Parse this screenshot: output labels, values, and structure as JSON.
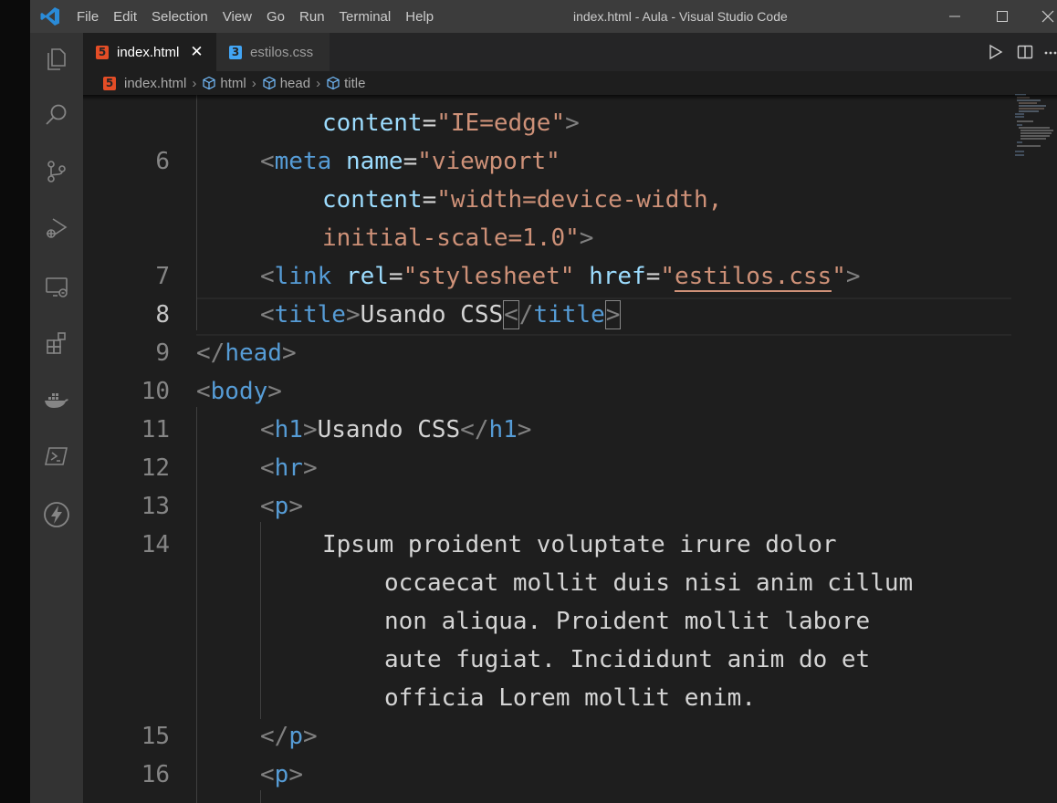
{
  "window": {
    "title": "index.html - Aula - Visual Studio Code",
    "menu": [
      "File",
      "Edit",
      "Selection",
      "View",
      "Go",
      "Run",
      "Terminal",
      "Help"
    ]
  },
  "activity_bar": [
    "explorer-icon",
    "search-icon",
    "source-control-icon",
    "run-debug-icon",
    "remote-explorer-icon",
    "extensions-icon",
    "docker-icon",
    "powershell-icon",
    "thunder-client-icon"
  ],
  "tabs": [
    {
      "label": "index.html",
      "icon": "html5-icon",
      "active": true,
      "close": "✕"
    },
    {
      "label": "estilos.css",
      "icon": "css3-icon",
      "active": false
    }
  ],
  "breadcrumb": [
    "index.html",
    "html",
    "head",
    "title"
  ],
  "editor": {
    "line_numbers": [
      "6",
      "7",
      "8",
      "9",
      "10",
      "11",
      "12",
      "13",
      "14",
      "15",
      "16"
    ],
    "current_line": "8",
    "tokens": {
      "meta": "meta",
      "name_attr": "name",
      "viewport": "\"viewport\"",
      "content_attr": "content",
      "ie_edge": "\"IE=edge\"",
      "width_val": "\"width=device-width,",
      "initial_scale": "initial-scale=1.0\"",
      "link": "link",
      "rel_attr": "rel",
      "stylesheet": "\"stylesheet\"",
      "href_attr": "href",
      "href_val_open": "\"",
      "href_file": "estilos.css",
      "href_val_close": "\"",
      "title_tag": "title",
      "title_text": "Usando CSS",
      "head_tag": "head",
      "body_tag": "body",
      "h1_tag": "h1",
      "h1_text": "Usando CSS",
      "hr_tag": "hr",
      "p_tag": "p",
      "paragraph": [
        "Ipsum proident voluptate irure dolor",
        "occaecat mollit duis nisi anim cillum",
        "non aliqua. Proident mollit labore",
        "aute fugiat. Incididunt anim do et",
        "officia Lorem mollit enim."
      ]
    }
  },
  "colors": {
    "background": "#1e1e1e",
    "tag": "#569cd6",
    "attribute": "#9cdcfe",
    "string": "#ce9178",
    "bracket": "#808080",
    "text": "#d4d4d4"
  }
}
